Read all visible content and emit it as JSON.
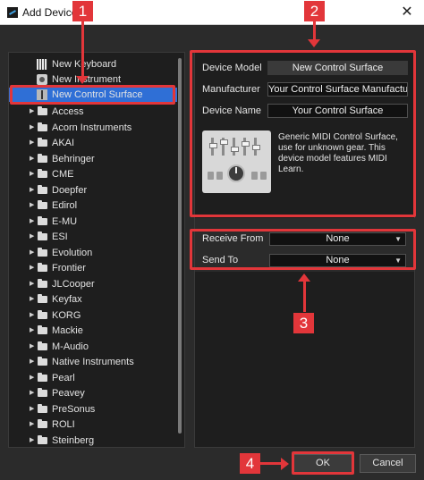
{
  "window": {
    "title": "Add Device",
    "close_glyph": "✕"
  },
  "tree": {
    "devices": [
      {
        "label": "New Keyboard",
        "icon": "keyboard-icon"
      },
      {
        "label": "New Instrument",
        "icon": "instrument-icon"
      },
      {
        "label": "New Control Surface",
        "icon": "control-surface-icon",
        "selected": true
      }
    ],
    "manufacturers": [
      "Access",
      "Acorn Instruments",
      "AKAI",
      "Behringer",
      "CME",
      "Doepfer",
      "Edirol",
      "E-MU",
      "ESI",
      "Evolution",
      "Frontier",
      "JLCooper",
      "Keyfax",
      "KORG",
      "Mackie",
      "M-Audio",
      "Native Instruments",
      "Pearl",
      "Peavey",
      "PreSonus",
      "ROLI",
      "Steinberg"
    ]
  },
  "details": {
    "device_model_label": "Device Model",
    "device_model_value": "New Control Surface",
    "manufacturer_label": "Manufacturer",
    "manufacturer_value": "Your Control Surface Manufacturer",
    "device_name_label": "Device Name",
    "device_name_value": "Your Control Surface",
    "description": "Generic MIDI Control Surface, use for unknown gear. This device model features MIDI Learn."
  },
  "ports": {
    "receive_from_label": "Receive From",
    "receive_from_value": "None",
    "send_to_label": "Send To",
    "send_to_value": "None"
  },
  "buttons": {
    "ok_label": "OK",
    "cancel_label": "Cancel"
  },
  "callouts": {
    "one": "1",
    "two": "2",
    "three": "3",
    "four": "4"
  },
  "colors": {
    "accent_selection": "#2f6fd6",
    "callout_red": "#e2363a",
    "dialog_background": "#2b2b2b"
  }
}
